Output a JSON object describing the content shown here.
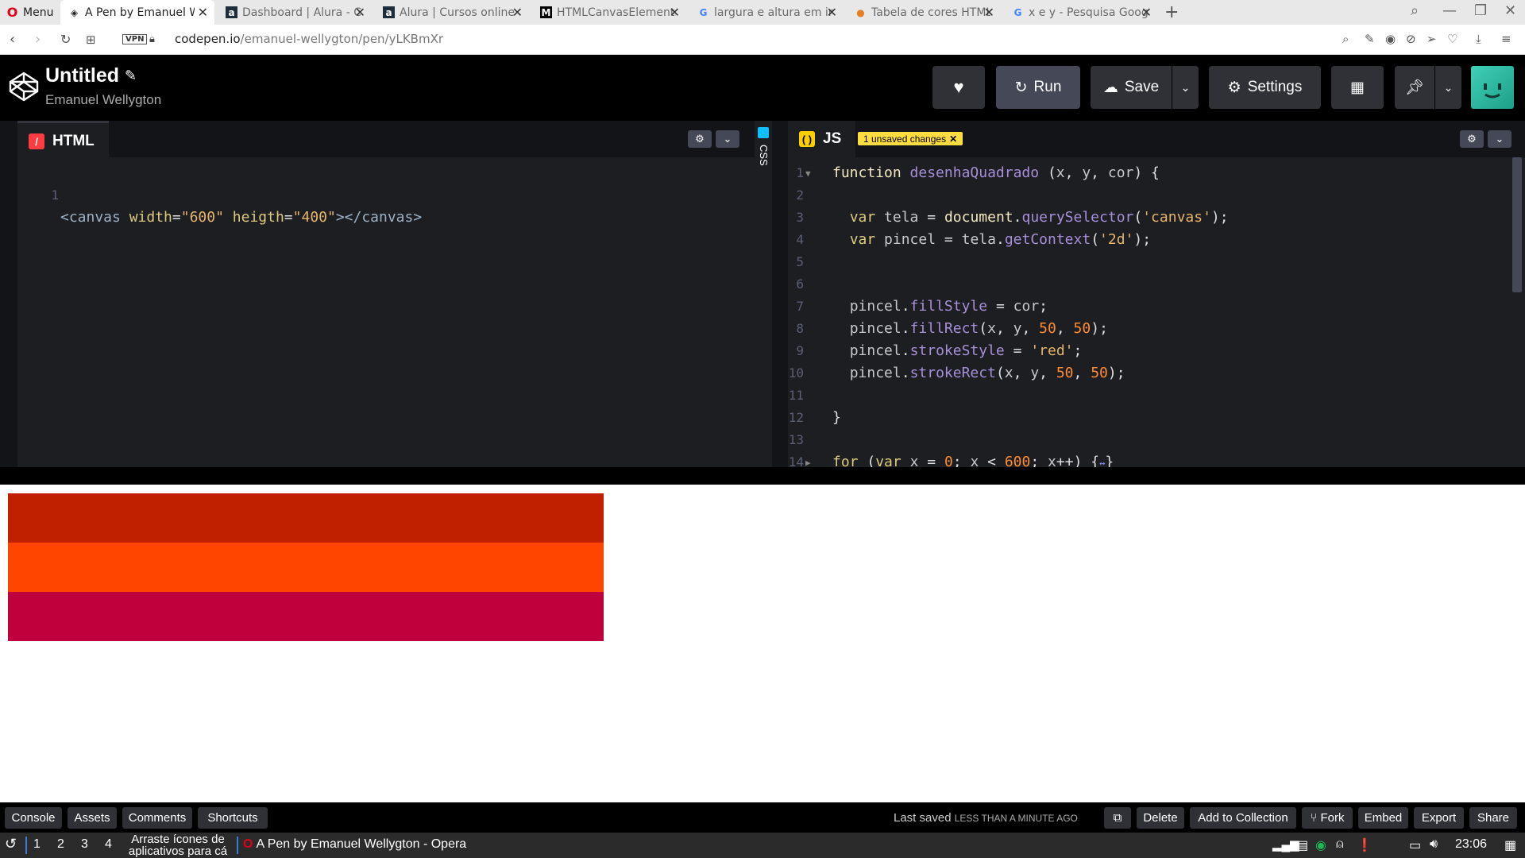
{
  "browser": {
    "menu_label": "Menu",
    "tabs": [
      {
        "title": "A Pen by Emanuel We",
        "icon": "codepen-icon",
        "active": true
      },
      {
        "title": "Dashboard | Alura - Cu",
        "icon": "alura-icon"
      },
      {
        "title": "Alura | Cursos online c",
        "icon": "alura-icon"
      },
      {
        "title": "HTMLCanvasElement.",
        "icon": "mdn-icon"
      },
      {
        "title": "largura e altura em in",
        "icon": "google-icon"
      },
      {
        "title": "Tabela de cores HTML",
        "icon": "github-icon"
      },
      {
        "title": "x e y - Pesquisa Goog",
        "icon": "google-icon"
      }
    ],
    "vpn_label": "VPN",
    "url_host": "codepen.io",
    "url_path": "/emanuel-wellygton/pen/yLKBmXr"
  },
  "header": {
    "title": "Untitled",
    "author": "Emanuel Wellygton",
    "run_label": "Run",
    "save_label": "Save",
    "settings_label": "Settings"
  },
  "editors": {
    "html": {
      "label": "HTML",
      "lines": [
        {
          "no": "1"
        }
      ]
    },
    "css_label": "CSS",
    "js": {
      "label": "JS",
      "unsaved": "1 unsaved changes",
      "line_numbers": [
        "1",
        "2",
        "3",
        "4",
        "5",
        "6",
        "7",
        "8",
        "9",
        "10",
        "11",
        "12",
        "13",
        "14"
      ]
    }
  },
  "preview": {
    "colors": [
      "#c02000",
      "#ff4500",
      "#c0003c"
    ]
  },
  "footer": {
    "console": "Console",
    "assets": "Assets",
    "comments": "Comments",
    "shortcuts": "Shortcuts",
    "last_saved_prefix": "Last saved",
    "last_saved_time": "LESS THAN A MINUTE AGO",
    "delete": "Delete",
    "add_to_collection": "Add to Collection",
    "fork": "Fork",
    "embed": "Embed",
    "export": "Export",
    "share": "Share"
  },
  "taskbar": {
    "workspaces": [
      "1",
      "2",
      "3",
      "4"
    ],
    "hint_line1": "Arraste ícones de",
    "hint_line2": "aplicativos para cá",
    "window_title": "A Pen by Emanuel Wellygton - Opera",
    "clock": "23:06"
  }
}
